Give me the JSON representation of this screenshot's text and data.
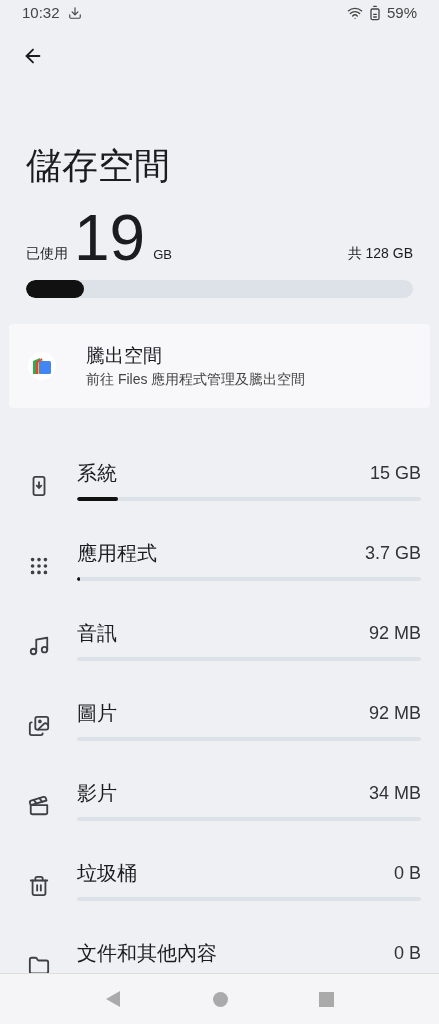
{
  "status_bar": {
    "time": "10:32",
    "battery": "59%"
  },
  "title": "儲存空間",
  "usage": {
    "used_label": "已使用",
    "used": "19",
    "unit": "GB",
    "total": "共 128 GB",
    "level": 0.15
  },
  "free_up": {
    "title": "騰出空間",
    "subtitle": "前往 Files 應用程式管理及騰出空間"
  },
  "categories": [
    {
      "kind": "system",
      "name": "系統",
      "size": "15 GB",
      "level": 0.12
    },
    {
      "kind": "apps",
      "name": "應用程式",
      "size": "3.7 GB",
      "level": 0.01
    },
    {
      "kind": "audio",
      "name": "音訊",
      "size": "92 MB"
    },
    {
      "kind": "images",
      "name": "圖片",
      "size": "92 MB"
    },
    {
      "kind": "videos",
      "name": "影片",
      "size": "34 MB"
    },
    {
      "kind": "trash",
      "name": "垃圾桶",
      "size": "0 B"
    },
    {
      "kind": "documents",
      "name": "文件和其他內容",
      "size": "0 B"
    }
  ]
}
